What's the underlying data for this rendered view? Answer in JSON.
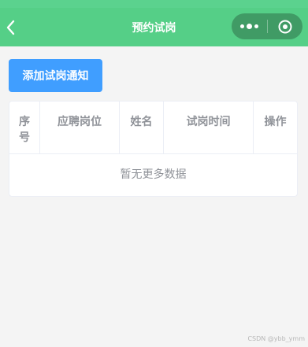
{
  "colors": {
    "nav_bar": "#55cf87",
    "page_background": "#f4f4f4",
    "primary_button": "#409eff",
    "table_header_text": "#909399",
    "table_border": "#ebeef5"
  },
  "navbar": {
    "title": "预约试岗",
    "back_icon": "chevron-left-icon",
    "capsule": {
      "more_icon": "three-dots-icon",
      "close_icon": "target-circle-icon"
    }
  },
  "toolbar": {
    "add_label": "添加试岗通知"
  },
  "table": {
    "columns": [
      "序号",
      "应聘岗位",
      "姓名",
      "试岗时间",
      "操作"
    ],
    "empty_text": "暂无更多数据"
  },
  "watermark": "CSDN @ybb_ymm"
}
